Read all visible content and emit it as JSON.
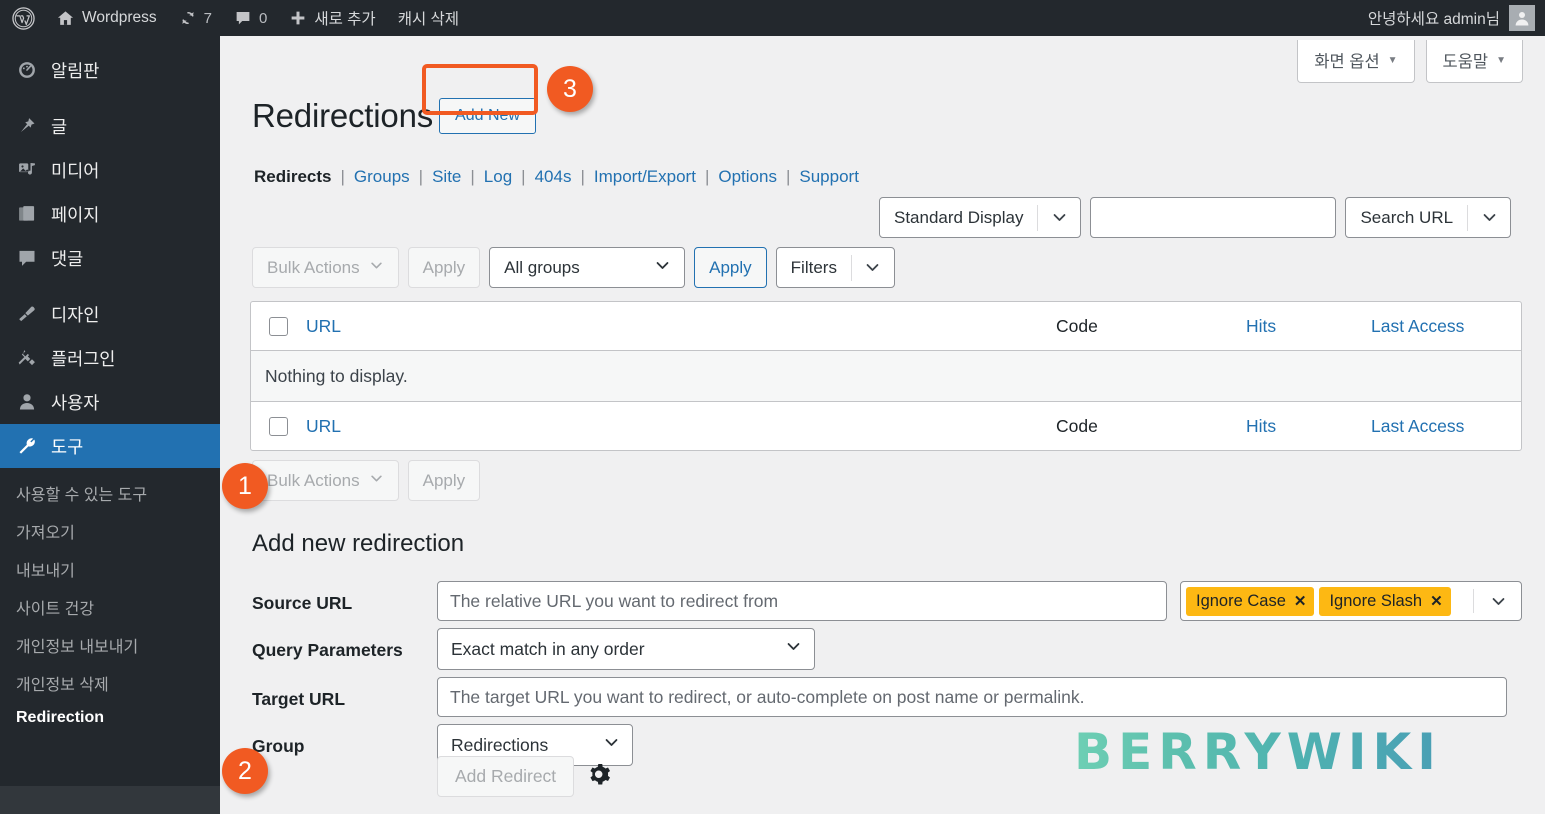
{
  "adminbar": {
    "logo_icon": "wordpress-logo-icon",
    "site_icon": "home-icon",
    "site_name": "Wordpress",
    "updates_icon": "updates-refresh-icon",
    "updates_count": "7",
    "comments_icon": "comment-bubble-icon",
    "comments_count": "0",
    "new_icon": "plus-icon",
    "new_label": "새로 추가",
    "cache_label": "캐시 삭제",
    "greeting": "안녕하세요 admin님",
    "avatar_icon": "avatar-icon"
  },
  "sidebar": {
    "items": [
      {
        "label": "알림판",
        "icon": "dashboard-icon"
      },
      {
        "label": "글",
        "icon": "posts-pin-icon"
      },
      {
        "label": "미디어",
        "icon": "media-icon"
      },
      {
        "label": "페이지",
        "icon": "pages-icon"
      },
      {
        "label": "댓글",
        "icon": "comments-icon"
      },
      {
        "label": "디자인",
        "icon": "appearance-brush-icon"
      },
      {
        "label": "플러그인",
        "icon": "plugins-plug-icon"
      },
      {
        "label": "사용자",
        "icon": "users-icon"
      },
      {
        "label": "도구",
        "icon": "tools-wrench-icon"
      }
    ],
    "submenu": [
      {
        "label": "사용할 수 있는 도구"
      },
      {
        "label": "가져오기"
      },
      {
        "label": "내보내기"
      },
      {
        "label": "사이트 건강"
      },
      {
        "label": "개인정보 내보내기"
      },
      {
        "label": "개인정보 삭제"
      },
      {
        "label": "Redirection"
      }
    ]
  },
  "screen_meta": {
    "screen_options": "화면 옵션",
    "help": "도움말",
    "caret_icon": "caret-down-icon"
  },
  "header": {
    "title": "Redirections",
    "add_new": "Add New"
  },
  "tabs": [
    {
      "label": "Redirects",
      "current": true
    },
    {
      "label": "Groups"
    },
    {
      "label": "Site"
    },
    {
      "label": "Log"
    },
    {
      "label": "404s"
    },
    {
      "label": "Import/Export"
    },
    {
      "label": "Options"
    },
    {
      "label": "Support"
    }
  ],
  "toolbar": {
    "display_mode": "Standard Display",
    "search_value": "",
    "search_placeholder": "",
    "search_type": "Search URL",
    "chevron_icon": "chevron-down-icon"
  },
  "bulk": {
    "bulk_actions": "Bulk Actions",
    "apply": "Apply",
    "group_filter": "All groups",
    "apply2": "Apply",
    "filters": "Filters"
  },
  "table": {
    "columns": {
      "url": "URL",
      "code": "Code",
      "hits": "Hits",
      "last_access": "Last Access"
    },
    "empty_message": "Nothing to display."
  },
  "form": {
    "title": "Add new redirection",
    "source_url_label": "Source URL",
    "source_url_placeholder": "The relative URL you want to redirect from",
    "query_parameters_label": "Query Parameters",
    "query_parameters_value": "Exact match in any order",
    "target_url_label": "Target URL",
    "target_url_placeholder": "The target URL you want to redirect, or auto-complete on post name or permalink.",
    "group_label": "Group",
    "group_value": "Redirections",
    "flags": [
      {
        "label": "Ignore Case",
        "remove_icon": "close-x-icon"
      },
      {
        "label": "Ignore Slash",
        "remove_icon": "close-x-icon"
      }
    ],
    "add_redirect": "Add Redirect",
    "gear_icon": "gear-icon"
  },
  "annotations": [
    {
      "number": "1"
    },
    {
      "number": "2"
    },
    {
      "number": "3"
    }
  ],
  "watermark": {
    "text": "BERRYWIKI"
  },
  "colors": {
    "accent": "#2271b1",
    "annotation": "#f15a22",
    "chip": "#fdb813",
    "adminbar": "#23282d"
  }
}
